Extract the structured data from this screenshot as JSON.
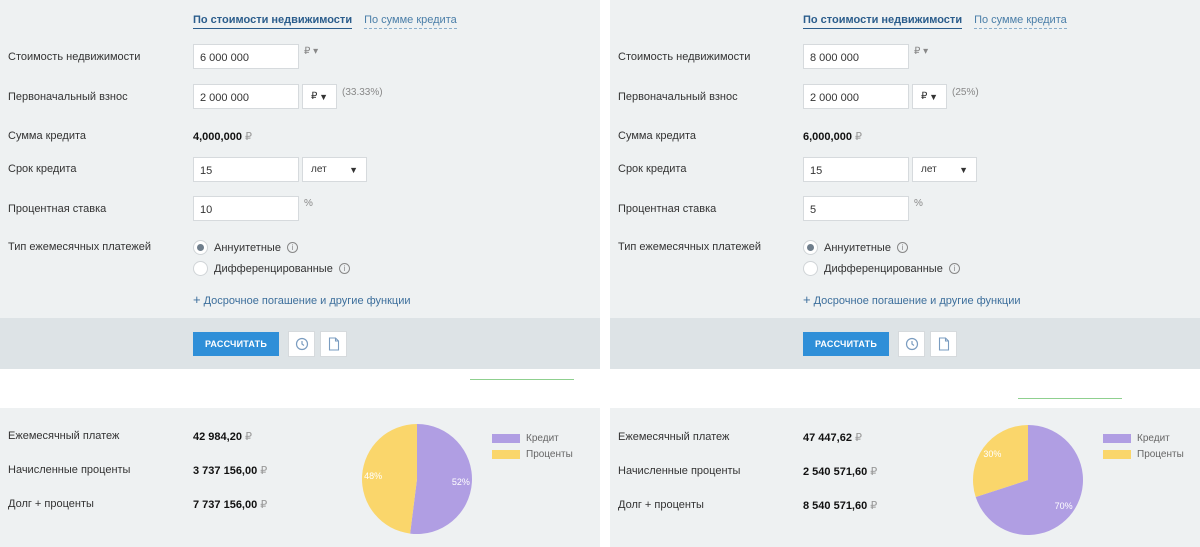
{
  "colors": {
    "credit": "#b09ee3",
    "interest": "#fad66b",
    "accent": "#2f8fd8"
  },
  "calculators": [
    {
      "tabs": {
        "active": "По стоимости недвижимости",
        "inactive": "По сумме кредита"
      },
      "fields": {
        "property_cost_label": "Стоимость недвижимости",
        "property_cost_value": "6 000 000",
        "property_cost_currency": "₽",
        "down_payment_label": "Первоначальный взнос",
        "down_payment_value": "2 000 000",
        "down_payment_currency": "₽",
        "down_payment_percent": "(33.33%)",
        "loan_amount_label": "Сумма кредита",
        "loan_amount_value": "4,000,000",
        "loan_amount_currency": "₽",
        "term_label": "Срок кредита",
        "term_value": "15",
        "term_unit": "лет",
        "rate_label": "Процентная ставка",
        "rate_value": "10",
        "rate_unit": "%",
        "payment_type_label": "Тип ежемесячных платежей",
        "payment_type_annuity": "Аннуитетные",
        "payment_type_diff": "Дифференцированные",
        "more_link": "Досрочное погашение и другие функции"
      },
      "calc_button": "РАССЧИТАТЬ",
      "results": {
        "monthly_label": "Ежемесячный платеж",
        "monthly_value": "42 984,20",
        "interest_label": "Начисленные проценты",
        "interest_value": "3 737 156,00",
        "total_label": "Долг + проценты",
        "total_value": "7 737 156,00",
        "currency": "₽"
      },
      "pie": {
        "credit_pct": 52,
        "interest_pct": 48,
        "credit_label": "52%",
        "interest_label": "48%"
      },
      "legend": {
        "credit": "Кредит",
        "interest": "Проценты"
      }
    },
    {
      "tabs": {
        "active": "По стоимости недвижимости",
        "inactive": "По сумме кредита"
      },
      "fields": {
        "property_cost_label": "Стоимость недвижимости",
        "property_cost_value": "8 000 000",
        "property_cost_currency": "₽",
        "down_payment_label": "Первоначальный взнос",
        "down_payment_value": "2 000 000",
        "down_payment_currency": "₽",
        "down_payment_percent": "(25%)",
        "loan_amount_label": "Сумма кредита",
        "loan_amount_value": "6,000,000",
        "loan_amount_currency": "₽",
        "term_label": "Срок кредита",
        "term_value": "15",
        "term_unit": "лет",
        "rate_label": "Процентная ставка",
        "rate_value": "5",
        "rate_unit": "%",
        "payment_type_label": "Тип ежемесячных платежей",
        "payment_type_annuity": "Аннуитетные",
        "payment_type_diff": "Дифференцированные",
        "more_link": "Досрочное погашение и другие функции"
      },
      "calc_button": "РАССЧИТАТЬ",
      "results": {
        "monthly_label": "Ежемесячный платеж",
        "monthly_value": "47 447,62",
        "interest_label": "Начисленные проценты",
        "interest_value": "2 540 571,60",
        "total_label": "Долг + проценты",
        "total_value": "8 540 571,60",
        "currency": "₽"
      },
      "pie": {
        "credit_pct": 70,
        "interest_pct": 30,
        "credit_label": "70%",
        "interest_label": "30%"
      },
      "legend": {
        "credit": "Кредит",
        "interest": "Проценты"
      }
    }
  ]
}
